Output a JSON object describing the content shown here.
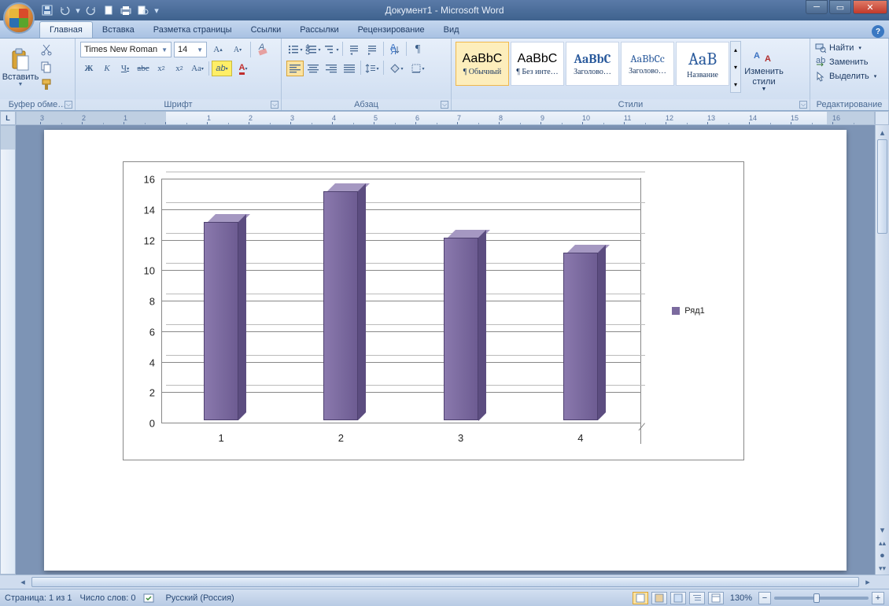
{
  "window": {
    "title": "Документ1 - Microsoft Word"
  },
  "qat_icons": [
    "save",
    "undo",
    "redo",
    "new",
    "print",
    "preview"
  ],
  "tabs": {
    "items": [
      "Главная",
      "Вставка",
      "Разметка страницы",
      "Ссылки",
      "Рассылки",
      "Рецензирование",
      "Вид"
    ],
    "active": 0
  },
  "ribbon": {
    "clipboard": {
      "paste": "Вставить",
      "label": "Буфер обме…"
    },
    "font": {
      "label": "Шрифт",
      "family": "Times New Roman",
      "size": "14"
    },
    "paragraph": {
      "label": "Абзац"
    },
    "styles": {
      "label": "Стили",
      "change_styles": "Изменить стили",
      "items": [
        {
          "sample": "AaBbC",
          "name": "¶ Обычный",
          "active": true,
          "heading": false
        },
        {
          "sample": "AaBbC",
          "name": "¶ Без инте…",
          "active": false,
          "heading": false
        },
        {
          "sample": "AaBbC",
          "name": "Заголово…",
          "active": false,
          "heading": true
        },
        {
          "sample": "AaBbCc",
          "name": "Заголово…",
          "active": false,
          "heading": true
        },
        {
          "sample": "AaB",
          "name": "Название",
          "active": false,
          "heading": true
        }
      ]
    },
    "editing": {
      "label": "Редактирование",
      "find": "Найти",
      "replace": "Заменить",
      "select": "Выделить"
    }
  },
  "ruler_corner": "L",
  "status_bar": {
    "page": "Страница: 1 из 1",
    "words": "Число слов: 0",
    "language": "Русский (Россия)",
    "zoom": "130%"
  },
  "chart_data": {
    "type": "bar",
    "categories": [
      "1",
      "2",
      "3",
      "4"
    ],
    "series": [
      {
        "name": "Ряд1",
        "values": [
          13,
          15,
          12,
          11
        ]
      }
    ],
    "ylim": [
      0,
      16
    ],
    "yticks": [
      0,
      2,
      4,
      6,
      8,
      10,
      12,
      14,
      16
    ],
    "legend": "Ряд1",
    "bar_color": "#7b6a9e"
  }
}
